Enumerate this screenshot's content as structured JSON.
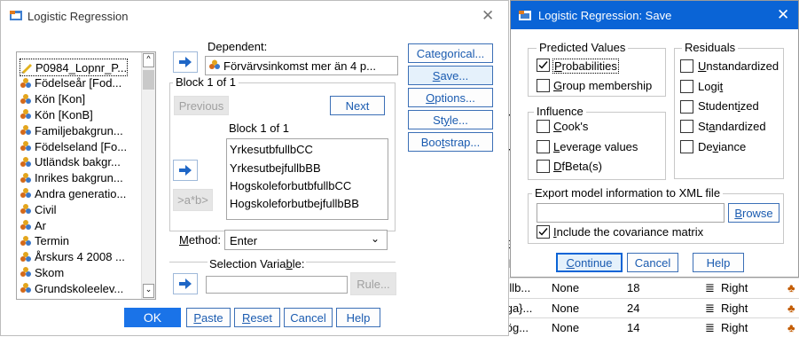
{
  "main": {
    "title": "Logistic Regression",
    "variables": [
      {
        "label": "P0984_Lopnr_P...",
        "icon": "pencil-ruler-icon"
      },
      {
        "label": "Födelseår [Fod...",
        "icon": "nominal-variable-icon"
      },
      {
        "label": "Kön [Kon]",
        "icon": "nominal-variable-icon"
      },
      {
        "label": "Kön [KonB]",
        "icon": "nominal-variable-icon"
      },
      {
        "label": "Familjebakgrun...",
        "icon": "nominal-variable-icon"
      },
      {
        "label": "Födelseland [Fo...",
        "icon": "nominal-variable-icon"
      },
      {
        "label": "Utländsk bakgr...",
        "icon": "nominal-variable-icon"
      },
      {
        "label": "Inrikes bakgrun...",
        "icon": "nominal-variable-icon"
      },
      {
        "label": "Andra generatio...",
        "icon": "nominal-variable-icon"
      },
      {
        "label": "Civil",
        "icon": "nominal-variable-icon"
      },
      {
        "label": "Ar",
        "icon": "nominal-variable-icon"
      },
      {
        "label": "Termin",
        "icon": "nominal-variable-icon"
      },
      {
        "label": "Årskurs 4 2008 ...",
        "icon": "nominal-variable-icon"
      },
      {
        "label": "Skom",
        "icon": "nominal-variable-icon"
      },
      {
        "label": "Grundskoleelev...",
        "icon": "nominal-variable-icon"
      }
    ],
    "dependent_label": "Dependent:",
    "dependent_value": "Förvärvsinkomst mer än 4 p...",
    "block_label": "Block 1 of 1",
    "previous": "Previous",
    "next": "Next",
    "inner_block_label": "Block 1 of 1",
    "covariates": [
      "YrkesutbfullbCC",
      "YrkesutbejfullbBB",
      "HogskoleforbutbfullbCC",
      "HogskoleforbutbejfullbBB"
    ],
    "interaction_btn": ">a*b>",
    "method_label": "Method:",
    "method_value": "Enter",
    "selection_label": "Selection Variable:",
    "rule_btn": "Rule...",
    "side_buttons": [
      "Categorical...",
      "Save...",
      "Options...",
      "Style...",
      "Bootstrap..."
    ],
    "bottom_buttons": [
      "OK",
      "Paste",
      "Reset",
      "Cancel",
      "Help"
    ]
  },
  "save": {
    "title": "Logistic Regression: Save",
    "predicted_title": "Predicted Values",
    "predicted": [
      {
        "label": "Probabilities",
        "checked": true
      },
      {
        "label": "Group membership",
        "checked": false
      }
    ],
    "influence_title": "Influence",
    "influence": [
      {
        "label": "Cook's",
        "checked": false
      },
      {
        "label": "Leverage values",
        "checked": false
      },
      {
        "label": "DfBeta(s)",
        "checked": false
      }
    ],
    "residuals_title": "Residuals",
    "residuals": [
      {
        "label": "Unstandardized",
        "checked": false
      },
      {
        "label": "Logit",
        "checked": false
      },
      {
        "label": "Studentized",
        "checked": false
      },
      {
        "label": "Standardized",
        "checked": false
      },
      {
        "label": "Deviance",
        "checked": false
      }
    ],
    "export_title": "Export model information to XML file",
    "export_value": "",
    "browse": "Browse",
    "include_cov": "Include the covariance matrix",
    "include_cov_checked": true,
    "buttons": [
      "Continue",
      "Cancel",
      "Help"
    ]
  },
  "background": {
    "rows": [
      {
        "name": "j fullb...",
        "missing": "None",
        "columns": "18",
        "align": "Right"
      },
      {
        "name": "vriga}...",
        "missing": "None",
        "columns": "24",
        "align": "Right"
      },
      {
        "name": "j hög...",
        "missing": "None",
        "columns": "14",
        "align": "Right"
      }
    ],
    "side_letters": [
      "Y",
      "y",
      "Y",
      "j",
      "j",
      "j",
      "E",
      "ul",
      "j"
    ]
  }
}
